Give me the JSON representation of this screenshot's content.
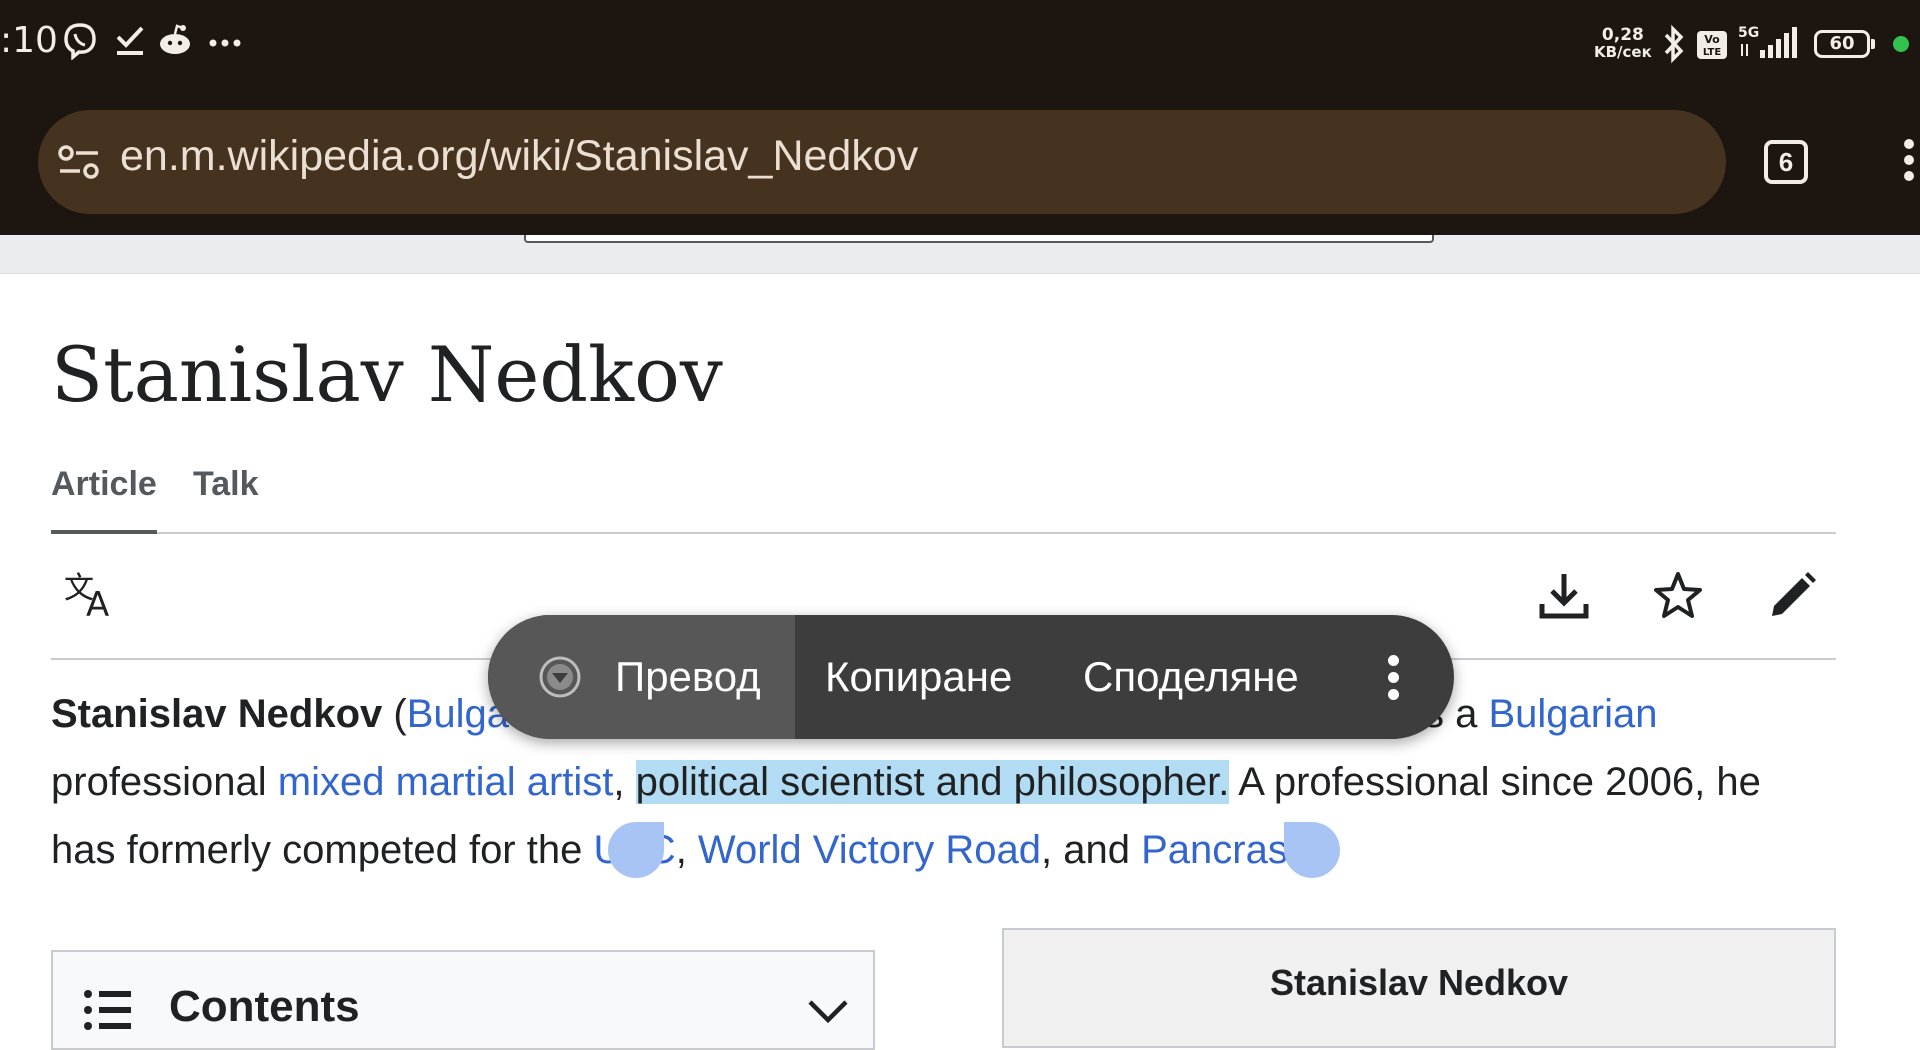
{
  "status_bar": {
    "time": ":10",
    "net_speed_value": "0,28",
    "net_speed_unit": "KB/сек",
    "network": "5G",
    "volte": "Vo LTE",
    "battery": "60",
    "icons": [
      "viber-icon",
      "checkmark-icon",
      "reddit-icon",
      "more-notifications-icon",
      "bluetooth-icon",
      "volte-icon",
      "signal-icon",
      "battery-icon"
    ]
  },
  "browser": {
    "url": "en.m.wikipedia.org/wiki/Stanislav_Nedkov",
    "tab_count": "6"
  },
  "page": {
    "title": "Stanislav Nedkov",
    "tabs": [
      {
        "label": "Article",
        "active": true
      },
      {
        "label": "Talk",
        "active": false
      }
    ]
  },
  "article": {
    "line1": {
      "bold_name": "Stanislav Nedkov",
      "paren_open": " (",
      "link_bulgarian_lang": "Bulga",
      "partial_text": "s a ",
      "link_bulgarian": "Bulgarian"
    },
    "line2": {
      "text_a": "professional ",
      "link_mma": "mixed martial artist",
      "comma": ", ",
      "selected_text": "political scientist and philosopher.",
      "text_b": " A professional since 2006, he"
    },
    "line3": {
      "text_a": "has formerly competed for the ",
      "link_ufc": "UFC",
      "comma": ", ",
      "link_wvr": "World Victory Road",
      "and": ", and ",
      "link_pancrase": "Pancrase",
      "period": "."
    }
  },
  "selection_popup": {
    "translate": "Превод",
    "copy": "Копиране",
    "share": "Споделяне"
  },
  "contents": {
    "title": "Contents"
  },
  "infobox": {
    "title": "Stanislav Nedkov"
  },
  "colors": {
    "status_bg": "#1c1510",
    "url_bg": "#45321f",
    "link": "#3366cc",
    "selection": "#b2dcf3",
    "popup_bg": "#3d3d3d"
  }
}
